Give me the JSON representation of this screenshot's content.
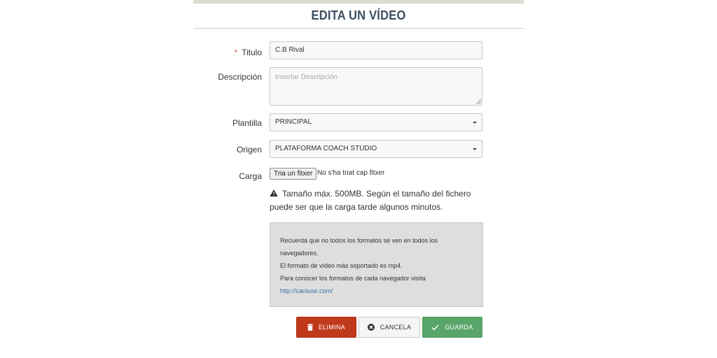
{
  "modal": {
    "title": "EDITA UN VÍDEO"
  },
  "form": {
    "title": {
      "required_mark": "*",
      "label": "Titulo",
      "value": "C.B Rival"
    },
    "description": {
      "label": "Descripción",
      "placeholder": "Insertar Descripción",
      "value": ""
    },
    "template": {
      "label": "Plantilla",
      "selected": "PRINCIPAL"
    },
    "origin": {
      "label": "Origen",
      "selected": "PLATAFORMA COACH STUDIO"
    },
    "upload": {
      "label": "Carga",
      "button_label": "Tria un fitxer",
      "status": "No s'ha triat cap fitxer"
    }
  },
  "warning": {
    "icon": "warning-triangle-icon",
    "text": "Tamaño máx. 500MB. Según el tamaño del fichero puede ser que la carga tarde algunos minutos."
  },
  "info_box": {
    "line1": "Recuerda que no todos los formatos se ven en todos los navegadores.",
    "line2": "El formato de vídeo más soportado es mp4.",
    "line3": "Para conocer los formatos de cada navegador visita",
    "link": "http://caniuse.com/"
  },
  "actions": {
    "delete_label": "ELIMINA",
    "delete_icon": "trash-icon",
    "cancel_label": "CANCELA",
    "cancel_icon": "close-circle-icon",
    "save_label": "GUARDA",
    "save_icon": "check-icon"
  },
  "colors": {
    "delete": "#c0391b",
    "save": "#5aa56a",
    "title": "#3d4e5f",
    "required": "#d9534f",
    "link": "#3a6fa5"
  }
}
